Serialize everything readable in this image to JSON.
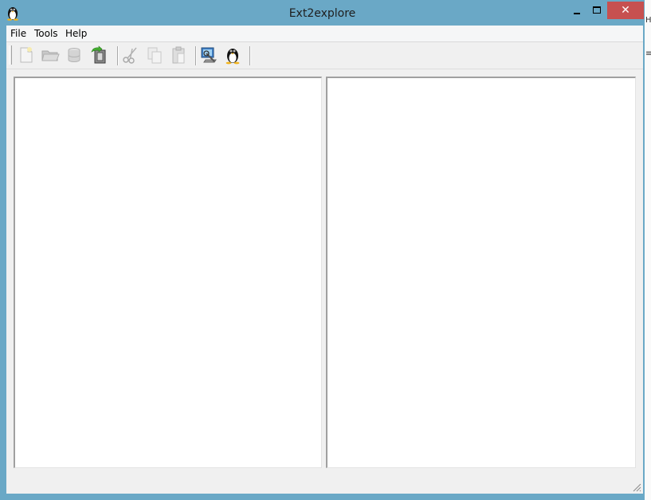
{
  "window": {
    "title": "Ext2explore",
    "app_icon": "tux-penguin-icon",
    "controls": {
      "minimize": "minimize-icon",
      "maximize": "maximize-icon",
      "close_label": "✕"
    }
  },
  "menubar": {
    "items": [
      {
        "label": "File"
      },
      {
        "label": "Tools"
      },
      {
        "label": "Help"
      }
    ]
  },
  "toolbar": {
    "buttons": [
      {
        "icon": "new-file-icon",
        "enabled": false
      },
      {
        "icon": "open-folder-icon",
        "enabled": false
      },
      {
        "icon": "disk-icon",
        "enabled": false
      },
      {
        "icon": "save-export-icon",
        "enabled": true
      },
      {
        "icon": "cut-icon",
        "enabled": false
      },
      {
        "icon": "copy-icon",
        "enabled": false
      },
      {
        "icon": "paste-icon",
        "enabled": false
      },
      {
        "icon": "scan-drive-icon",
        "enabled": true
      },
      {
        "icon": "linux-penguin-icon",
        "enabled": true
      }
    ]
  },
  "colors": {
    "frame": "#6aa8c6",
    "close_button": "#c75050",
    "client_background": "#f0f0f0",
    "pane_background": "#ffffff"
  }
}
